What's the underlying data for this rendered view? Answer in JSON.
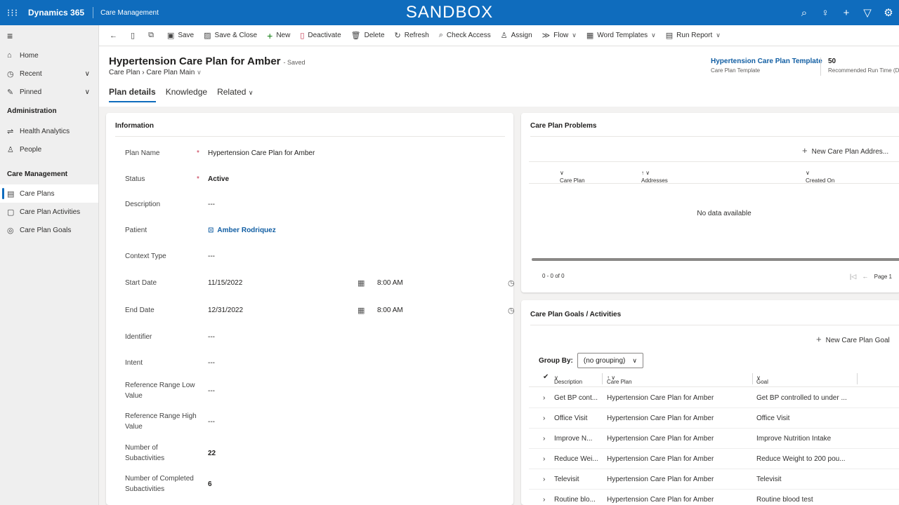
{
  "topbar": {
    "app_name": "Dynamics 365",
    "area": "Care Management",
    "environment_banner": "SANDBOX",
    "icons": [
      "search-icon",
      "lightbulb-icon",
      "plus-icon",
      "filter-icon",
      "gear-icon"
    ]
  },
  "sidebar": {
    "items": [
      {
        "label": "Home",
        "icon": "home-icon"
      },
      {
        "label": "Recent",
        "icon": "clock-icon"
      },
      {
        "label": "Pinned",
        "icon": "pin-icon"
      }
    ],
    "admin_section": "Administration",
    "admin_items": [
      {
        "label": "Health Analytics",
        "icon": "analytics-icon"
      },
      {
        "label": "People",
        "icon": "person-icon"
      }
    ],
    "care_section": "Care Management",
    "care_items": [
      {
        "label": "Care Plans",
        "icon": "care-plan-icon",
        "active": true
      },
      {
        "label": "Care Plan Activities",
        "icon": "activities-icon"
      },
      {
        "label": "Care Plan Goals",
        "icon": "goal-icon"
      }
    ]
  },
  "commands": {
    "save": "Save",
    "save_close": "Save & Close",
    "new": "New",
    "deactivate": "Deactivate",
    "delete": "Delete",
    "refresh": "Refresh",
    "check_access": "Check Access",
    "assign": "Assign",
    "flow": "Flow",
    "word_templates": "Word Templates",
    "run_report": "Run Report"
  },
  "header": {
    "title": "Hypertension Care Plan for Amber",
    "saved_status": "- Saved",
    "entity": "Care Plan",
    "form": "Care Plan Main",
    "template_value": "Hypertension Care Plan Template",
    "template_label": "Care Plan Template",
    "run_time_value": "50",
    "run_time_label": "Recommended Run Time (D"
  },
  "tabs": [
    "Plan details",
    "Knowledge",
    "Related"
  ],
  "info": {
    "title": "Information",
    "fields": {
      "plan_name": {
        "label": "Plan Name",
        "value": "Hypertension Care Plan for Amber"
      },
      "status": {
        "label": "Status",
        "value": "Active"
      },
      "description": {
        "label": "Description",
        "value": "---"
      },
      "patient": {
        "label": "Patient",
        "value": "Amber Rodriquez"
      },
      "context_type": {
        "label": "Context Type",
        "value": "---"
      },
      "start_date": {
        "label": "Start Date",
        "date": "11/15/2022",
        "time": "8:00 AM"
      },
      "end_date": {
        "label": "End Date",
        "date": "12/31/2022",
        "time": "8:00 AM"
      },
      "identifier": {
        "label": "Identifier",
        "value": "---"
      },
      "intent": {
        "label": "Intent",
        "value": "---"
      },
      "ref_low": {
        "label": "Reference Range Low Value",
        "value": "---"
      },
      "ref_high": {
        "label": "Reference Range High Value",
        "value": "---"
      },
      "num_sub": {
        "label": "Number of Subactivities",
        "value": "22"
      },
      "num_completed": {
        "label": "Number of Completed Subactivities",
        "value": "6"
      }
    },
    "required_marker": "*"
  },
  "problems": {
    "title": "Care Plan Problems",
    "new_button": "New Care Plan Addres...",
    "columns": [
      "Care Plan",
      "Addresses",
      "Created On"
    ],
    "empty_text": "No data available",
    "count_text": "0 - 0 of 0",
    "page_text": "Page 1"
  },
  "goals": {
    "title": "Care Plan Goals / Activities",
    "new_button": "New Care Plan Goal",
    "group_by_label": "Group By:",
    "group_by_value": "(no grouping)",
    "columns": [
      "Description",
      "Care Plan",
      "Goal"
    ],
    "rows": [
      {
        "description": "Get BP cont...",
        "care_plan": "Hypertension Care Plan for Amber",
        "goal": "Get BP controlled to under ..."
      },
      {
        "description": "Office Visit",
        "care_plan": "Hypertension Care Plan for Amber",
        "goal": "Office Visit"
      },
      {
        "description": "Improve N...",
        "care_plan": "Hypertension Care Plan for Amber",
        "goal": "Improve Nutrition Intake"
      },
      {
        "description": "Reduce Wei...",
        "care_plan": "Hypertension Care Plan for Amber",
        "goal": "Reduce Weight to 200 pou..."
      },
      {
        "description": "Televisit",
        "care_plan": "Hypertension Care Plan for Amber",
        "goal": "Televisit"
      },
      {
        "description": "Routine blo...",
        "care_plan": "Hypertension Care Plan for Amber",
        "goal": "Routine blood test"
      }
    ]
  }
}
